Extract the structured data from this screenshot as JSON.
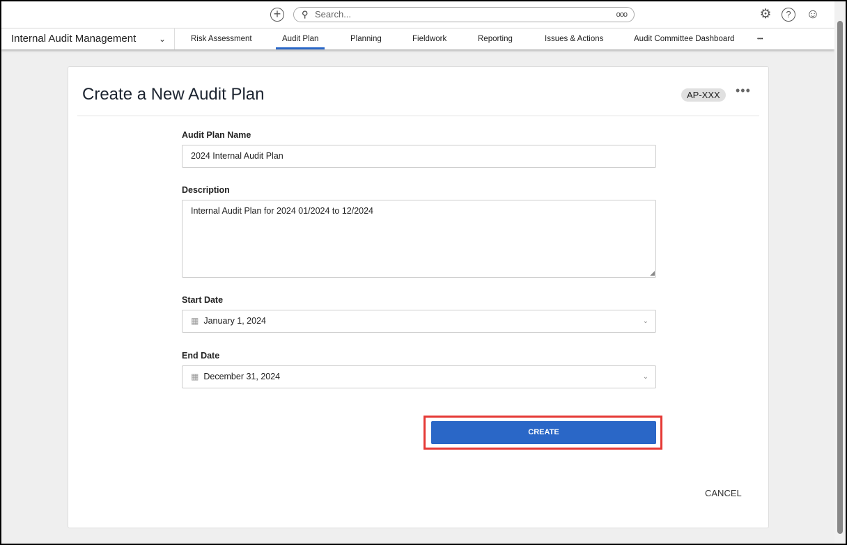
{
  "topbar": {
    "search_placeholder": "Search...",
    "options_glyph": "ooo"
  },
  "nav": {
    "app_name": "Internal Audit Management",
    "tabs": [
      "Risk Assessment",
      "Audit Plan",
      "Planning",
      "Fieldwork",
      "Reporting",
      "Issues & Actions",
      "Audit Committee Dashboard"
    ],
    "active_tab": "Audit Plan",
    "more": "•••"
  },
  "form": {
    "title": "Create a New Audit Plan",
    "id_badge": "AP-XXX",
    "more": "•••",
    "name_label": "Audit Plan Name",
    "name_value": "2024 Internal Audit Plan",
    "description_label": "Description",
    "description_value": "Internal Audit Plan for 2024 01/2024 to 12/2024",
    "start_label": "Start Date",
    "start_value": "January 1, 2024",
    "end_label": "End Date",
    "end_value": "December 31, 2024",
    "create_label": "CREATE",
    "cancel_label": "CANCEL"
  },
  "colors": {
    "accent": "#2a67c7",
    "highlight": "#e53935"
  }
}
